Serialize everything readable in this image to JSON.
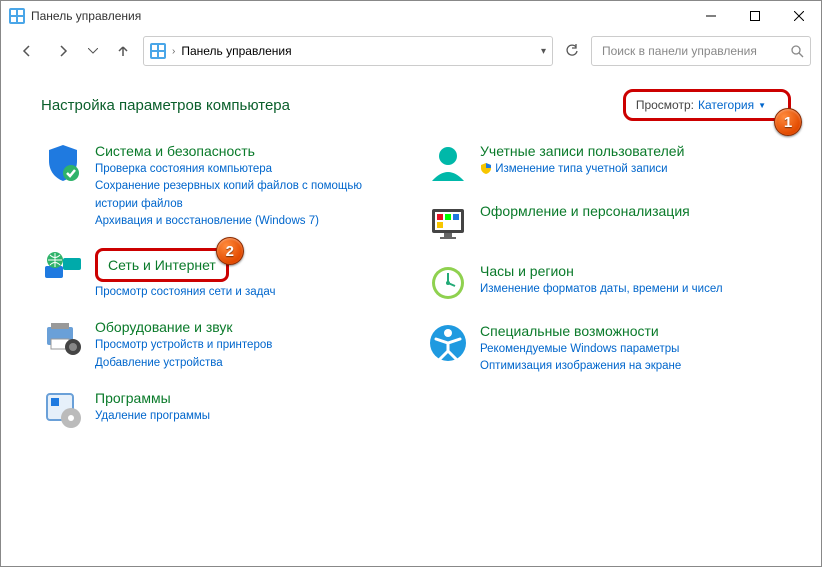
{
  "window": {
    "title": "Панель управления"
  },
  "breadcrumb": {
    "root": "Панель управления"
  },
  "search": {
    "placeholder": "Поиск в панели управления"
  },
  "page": {
    "title": "Настройка параметров компьютера"
  },
  "view": {
    "label": "Просмотр:",
    "value": "Категория"
  },
  "left": [
    {
      "title": "Система и безопасность",
      "links": [
        "Проверка состояния компьютера",
        "Сохранение резервных копий файлов с помощью истории файлов",
        "Архивация и восстановление (Windows 7)"
      ]
    },
    {
      "title": "Сеть и Интернет",
      "links": [
        "Просмотр состояния сети и задач"
      ],
      "highlight": true
    },
    {
      "title": "Оборудование и звук",
      "links": [
        "Просмотр устройств и принтеров",
        "Добавление устройства"
      ]
    },
    {
      "title": "Программы",
      "links": [
        "Удаление программы"
      ]
    }
  ],
  "right": [
    {
      "title": "Учетные записи пользователей",
      "links": [
        "Изменение типа учетной записи"
      ],
      "shield": true
    },
    {
      "title": "Оформление и персонализация",
      "links": []
    },
    {
      "title": "Часы и регион",
      "links": [
        "Изменение форматов даты, времени и чисел"
      ]
    },
    {
      "title": "Специальные возможности",
      "links": [
        "Рекомендуемые Windows параметры",
        "Оптимизация изображения на экране"
      ]
    }
  ],
  "badges": {
    "one": "1",
    "two": "2"
  }
}
